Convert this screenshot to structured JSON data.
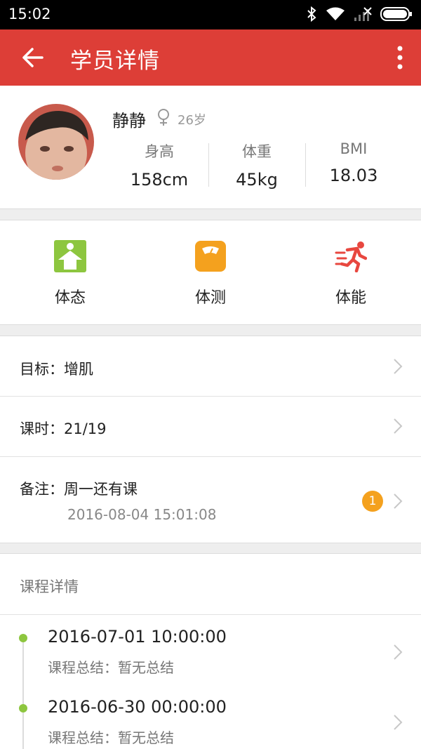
{
  "status_bar": {
    "time": "15:02",
    "icons": [
      "bluetooth-icon",
      "wifi-icon",
      "signal-icon",
      "battery-icon"
    ]
  },
  "app_bar": {
    "title": "学员详情",
    "back_icon": "arrow-left-icon",
    "more_icon": "more-vertical-icon",
    "background_color": "#dd3e37"
  },
  "profile": {
    "name": "静静",
    "gender_icon": "female-icon",
    "age": "26岁",
    "metrics": [
      {
        "label": "身高",
        "value": "158cm"
      },
      {
        "label": "体重",
        "value": "45kg"
      },
      {
        "label": "BMI",
        "value": "18.03"
      }
    ]
  },
  "categories": [
    {
      "label": "体态",
      "icon": "posture-icon",
      "color": "#8dc63f"
    },
    {
      "label": "体测",
      "icon": "scale-icon",
      "color": "#f4a11e"
    },
    {
      "label": "体能",
      "icon": "running-icon",
      "color": "#e8473f"
    }
  ],
  "info": {
    "goal": "目标：增肌",
    "lessons": "课时：21/19",
    "note": "备注：周一还有课",
    "note_time": "2016-08-04 15:01:08",
    "note_badge": "1"
  },
  "course_details": {
    "title": "课程详情",
    "entries": [
      {
        "datetime": "2016-07-01 10:00:00",
        "summary": "课程总结：暂无总结"
      },
      {
        "datetime": "2016-06-30 00:00:00",
        "summary": "课程总结：暂无总结"
      }
    ]
  }
}
